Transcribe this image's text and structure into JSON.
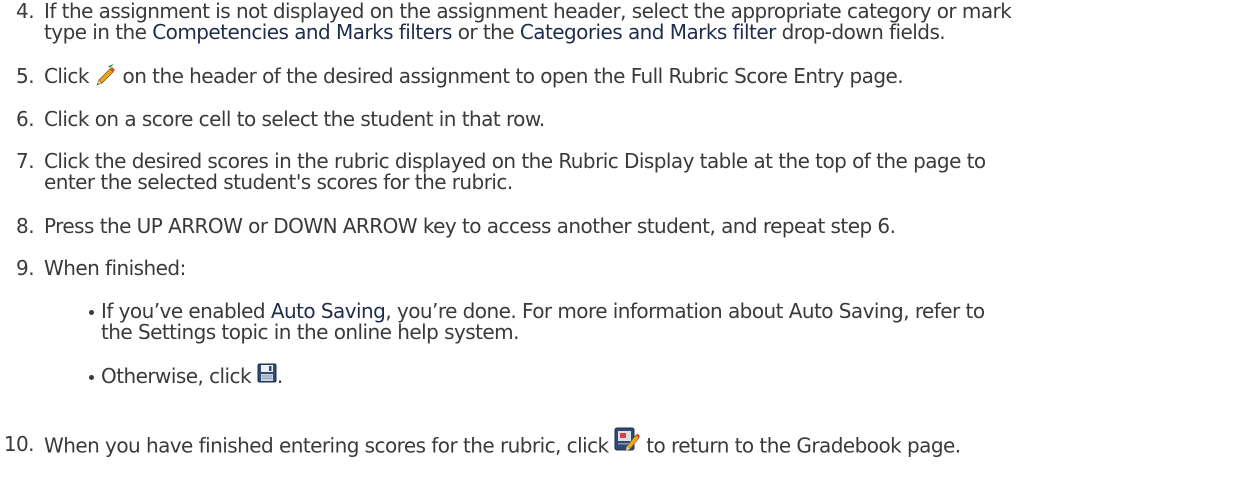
{
  "steps": [
    {
      "number": "4.",
      "line1_a": "If the assignment is not displayed on the assignment header, select the appropriate category or mark",
      "line2_a": "type in the ",
      "line2_b": "Competencies and Marks filters",
      "line2_c": " or the ",
      "line2_d": "Categories and Marks filter",
      "line2_e": " drop-down fields."
    },
    {
      "number": "5.",
      "text_a": "Click ",
      "icon": "pencil-icon",
      "text_b": " on the header of the desired assignment to open the Full Rubric Score Entry page."
    },
    {
      "number": "6.",
      "text": "Click on a score cell to select the student in that row."
    },
    {
      "number": "7.",
      "line1": "Click the desired scores in the rubric displayed on the Rubric Display table at the top of the page to",
      "line2": "enter the selected student's scores for the rubric."
    },
    {
      "number": "8.",
      "text": "Press the UP ARROW or DOWN ARROW key to access another student, and repeat step 6."
    },
    {
      "number": "9.",
      "text": "When finished:",
      "bullets": [
        {
          "line1_a": "If you’ve enabled ",
          "line1_b": "Auto Saving",
          "line1_c": ", you’re done. For more information about Auto Saving, refer to",
          "line2": "the Settings topic in the online help system."
        },
        {
          "text_a": "Otherwise, click ",
          "icon": "save-icon",
          "text_b": "."
        }
      ]
    },
    {
      "number": "10.",
      "text_a": "When you have finished entering scores for the rubric, click ",
      "icon": "return-to-gradebook-icon",
      "text_b": " to return to the Gradebook page."
    }
  ],
  "colors": {
    "body_text": "#3a3a3a",
    "ui_text": "#1f2d4d"
  }
}
